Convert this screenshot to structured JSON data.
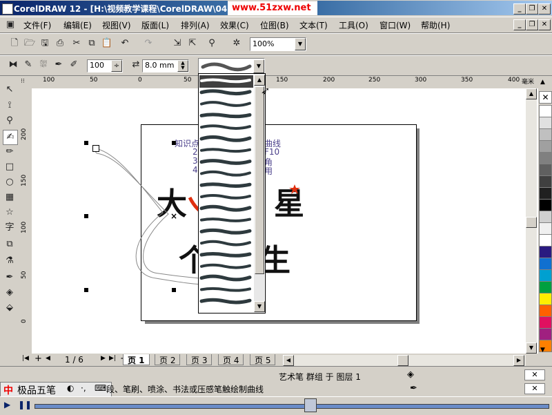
{
  "window": {
    "title": "CorelDRAW 12 - [H:\\视频教学课程\\CorelDRAW\\04：3",
    "watermark": "www.51zxw.net",
    "minimize": "_",
    "restore": "❐",
    "close": "✕"
  },
  "menu": {
    "items": [
      "文件(F)",
      "编辑(E)",
      "视图(V)",
      "版面(L)",
      "排列(A)",
      "效果(C)",
      "位图(B)",
      "文本(T)",
      "工具(O)",
      "窗口(W)",
      "帮助(H)"
    ]
  },
  "standard_toolbar": {
    "zoom": "100%"
  },
  "property_bar": {
    "smoothing": "100",
    "stroke_width": "8.0 mm"
  },
  "rulers": {
    "horizontal": [
      "100",
      "50",
      "0",
      "50",
      "150",
      "200",
      "250",
      "300",
      "350",
      "400",
      "毫米"
    ],
    "vertical": [
      "200",
      "150",
      "100",
      "50",
      "0"
    ],
    "corner_unit": "毫米"
  },
  "page_content": {
    "lines": [
      "知识点",
      "2",
      "3",
      "4"
    ],
    "right_fragments": [
      "曲线",
      "F10",
      "角",
      "用"
    ],
    "chars": [
      "大",
      "星",
      "个",
      "生"
    ]
  },
  "page_nav": {
    "counter": "1 / 6",
    "tabs": [
      "页 1",
      "页 2",
      "页 3",
      "页 4",
      "页 5"
    ]
  },
  "status": {
    "object_info": "艺术笔 群组 于 图层 1",
    "hint": "段、笔刷、喷涂、书法或压感笔触绘制曲线",
    "ime_name": "极品五笔",
    "ime_logo": "中"
  },
  "colors": {
    "title_start": "#0a246a",
    "title_end": "#3a6ea5",
    "accent_red": "#e03010",
    "page_text": "#4a3f8a"
  },
  "palette": [
    "#ffffff",
    "#e0e0e0",
    "#c0c0c0",
    "#a0a0a0",
    "#808080",
    "#606060",
    "#404040",
    "#202020",
    "#000000",
    "#d0d0d0",
    "#f0f0f0",
    "#ffffff",
    "#2a1a80",
    "#1070d0",
    "#00a0d0",
    "#00a040",
    "#ffee00",
    "#ff6000",
    "#e01060",
    "#a02080",
    "#ff8000"
  ]
}
